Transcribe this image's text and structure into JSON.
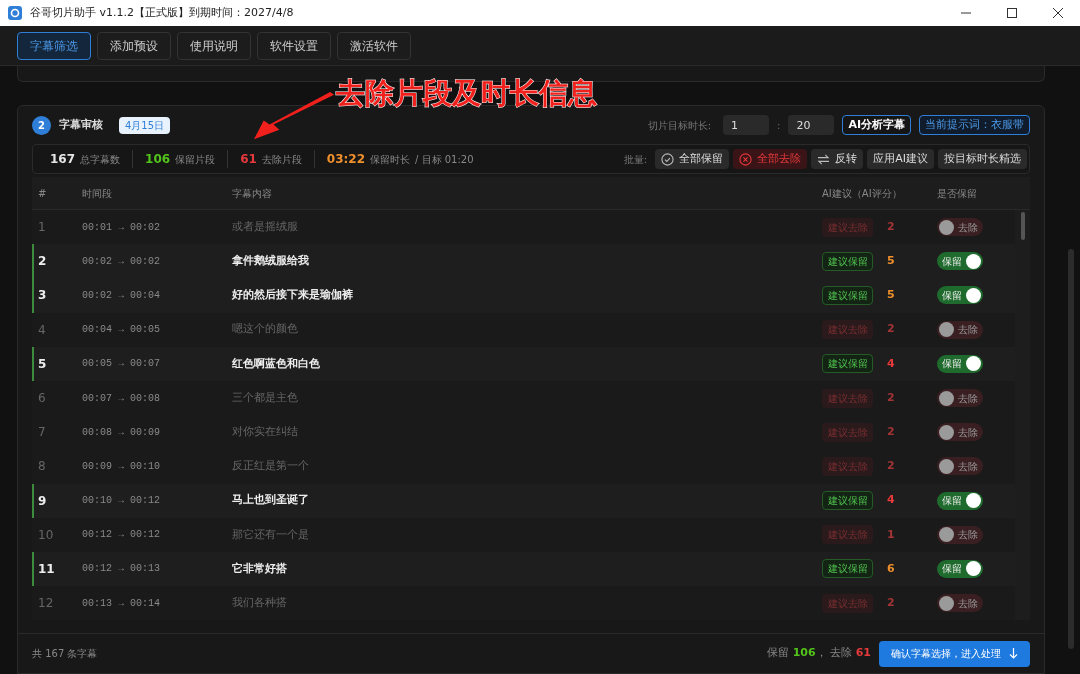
{
  "window": {
    "title": "谷哥切片助手 v1.1.2【正式版】到期时间：2027/4/8"
  },
  "tabs": [
    {
      "label": "字幕筛选",
      "selected": true
    },
    {
      "label": "添加预设",
      "selected": false
    },
    {
      "label": "使用说明",
      "selected": false
    },
    {
      "label": "软件设置",
      "selected": false
    },
    {
      "label": "激活软件",
      "selected": false
    }
  ],
  "annotation": {
    "text": "去除片段及时长信息"
  },
  "section": {
    "step": "2",
    "title": "字幕审核",
    "date": "4月15日",
    "target_label": "切片目标时长:",
    "minutes": "1",
    "separator": ":",
    "seconds": "20",
    "analyze_button": "AI分析字幕",
    "prompt_button": "当前提示词：衣服带"
  },
  "stats": [
    {
      "value": "167",
      "label": "总字幕数",
      "color": "#e5e5e5"
    },
    {
      "value": "106",
      "label": "保留片段",
      "color": "#52c41a"
    },
    {
      "value": "61",
      "label": "去除片段",
      "color": "#e5393b"
    },
    {
      "value": "03:22",
      "label": "保留时长",
      "color": "#f0902c",
      "note": "/ 目标 01:20"
    }
  ],
  "batch": {
    "label": "批量:",
    "buttons": [
      {
        "label": "全部保留",
        "kind": "check"
      },
      {
        "label": "全部去除",
        "kind": "danger"
      },
      {
        "label": "反转",
        "kind": "swap"
      },
      {
        "label": "应用AI建议",
        "kind": "plain"
      },
      {
        "label": "按目标时长精选",
        "kind": "plain"
      }
    ]
  },
  "table": {
    "columns": [
      "#",
      "时间段",
      "字幕内容",
      "AI建议（AI评分）",
      "是否保留"
    ],
    "rows": [
      {
        "index": "1",
        "start": "00:01",
        "arrow": "→",
        "end": "00:02",
        "text": "或者是摇绒服",
        "suggestion": "建议去除",
        "suggest_keep": false,
        "score": "2",
        "color": "#a33335",
        "toggle": "去除",
        "on": false
      },
      {
        "index": "2",
        "start": "00:02",
        "arrow": "→",
        "end": "00:02",
        "text": "拿件鹅绒服给我",
        "suggestion": "建议保留",
        "suggest_keep": true,
        "score": "5",
        "color": "#f0902c",
        "toggle": "保留",
        "on": true
      },
      {
        "index": "3",
        "start": "00:02",
        "arrow": "→",
        "end": "00:04",
        "text": "好的然后接下来是瑜伽裤",
        "suggestion": "建议保留",
        "suggest_keep": true,
        "score": "5",
        "color": "#f0902c",
        "toggle": "保留",
        "on": true
      },
      {
        "index": "4",
        "start": "00:04",
        "arrow": "→",
        "end": "00:05",
        "text": "嗯这个的颜色",
        "suggestion": "建议去除",
        "suggest_keep": false,
        "score": "2",
        "color": "#a33335",
        "toggle": "去除",
        "on": false
      },
      {
        "index": "5",
        "start": "00:05",
        "arrow": "→",
        "end": "00:07",
        "text": "红色啊蓝色和白色",
        "suggestion": "建议保留",
        "suggest_keep": true,
        "score": "4",
        "color": "#e5393b",
        "toggle": "保留",
        "on": true
      },
      {
        "index": "6",
        "start": "00:07",
        "arrow": "→",
        "end": "00:08",
        "text": "三个都是主色",
        "suggestion": "建议去除",
        "suggest_keep": false,
        "score": "2",
        "color": "#a33335",
        "toggle": "去除",
        "on": false
      },
      {
        "index": "7",
        "start": "00:08",
        "arrow": "→",
        "end": "00:09",
        "text": "对你实在纠结",
        "suggestion": "建议去除",
        "suggest_keep": false,
        "score": "2",
        "color": "#a33335",
        "toggle": "去除",
        "on": false
      },
      {
        "index": "8",
        "start": "00:09",
        "arrow": "→",
        "end": "00:10",
        "text": "反正红是第一个",
        "suggestion": "建议去除",
        "suggest_keep": false,
        "score": "2",
        "color": "#a33335",
        "toggle": "去除",
        "on": false
      },
      {
        "index": "9",
        "start": "00:10",
        "arrow": "→",
        "end": "00:12",
        "text": "马上也到圣诞了",
        "suggestion": "建议保留",
        "suggest_keep": true,
        "score": "4",
        "color": "#e5393b",
        "toggle": "保留",
        "on": true
      },
      {
        "index": "10",
        "start": "00:12",
        "arrow": "→",
        "end": "00:12",
        "text": "那它还有一个是",
        "suggestion": "建议去除",
        "suggest_keep": false,
        "score": "1",
        "color": "#a33335",
        "toggle": "去除",
        "on": false
      },
      {
        "index": "11",
        "start": "00:12",
        "arrow": "→",
        "end": "00:13",
        "text": "它非常好搭",
        "suggestion": "建议保留",
        "suggest_keep": true,
        "score": "6",
        "color": "#f0902c",
        "toggle": "保留",
        "on": true
      },
      {
        "index": "12",
        "start": "00:13",
        "arrow": "→",
        "end": "00:14",
        "text": "我们各种搭",
        "suggestion": "建议去除",
        "suggest_keep": false,
        "score": "2",
        "color": "#a33335",
        "toggle": "去除",
        "on": false
      }
    ]
  },
  "footer": {
    "total": "共 167 条字幕",
    "keep_label": "保留",
    "keep_value": "106",
    "sep": "，",
    "remove_label": "去除",
    "remove_value": "61",
    "confirm_button": "确认字幕选择，进入处理"
  }
}
